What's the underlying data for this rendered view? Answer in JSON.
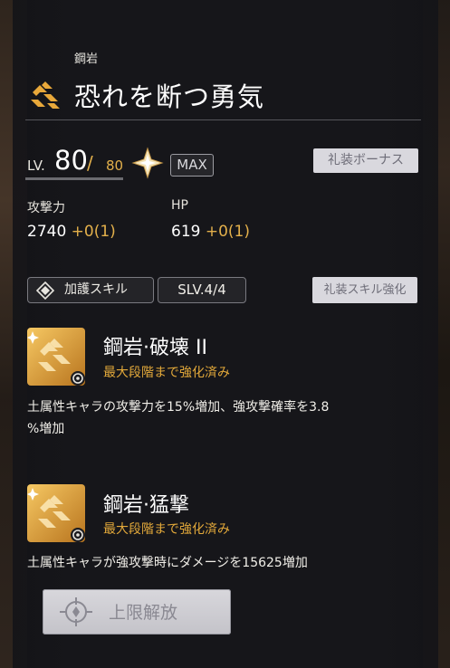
{
  "header": {
    "element_label": "鋼岩",
    "title": "恐れを断つ勇気"
  },
  "level": {
    "prefix": "LV.",
    "current": "80",
    "slash": "/",
    "max": "80",
    "max_badge": "MAX"
  },
  "buttons": {
    "bonus": "礼装ボーナス",
    "skill_enhance": "礼装スキル強化",
    "limit_break": "上限解放"
  },
  "stats": [
    {
      "label": "攻撃力",
      "value": "2740",
      "add": "+0(1)"
    },
    {
      "label": "HP",
      "value": "619",
      "add": "+0(1)"
    }
  ],
  "skill_section": {
    "tag_label": "加護スキル",
    "slv": "SLV.4/4"
  },
  "skills": [
    {
      "name": "鋼岩·破壊 II",
      "status": "最大段階まで強化済み",
      "desc_line1": "土属性キャラの攻撃力を15%増加、強攻撃確率を3.8",
      "desc_line2": "%増加"
    },
    {
      "name": "鋼岩·猛撃",
      "status": "最大段階まで強化済み",
      "desc_line1": "土属性キャラが強攻撃時にダメージを15625増加"
    }
  ],
  "colors": {
    "accent_gold": "#e3b04b",
    "status_orange": "#e3a93a",
    "icon_orange": "#e8a83a"
  },
  "icons": {
    "title": "earth-element-icon",
    "star": "star-sparkle-icon",
    "tag": "blessing-diamond-icon",
    "skill_badge": "gear-badge-icon",
    "limit": "limit-break-target-icon"
  }
}
